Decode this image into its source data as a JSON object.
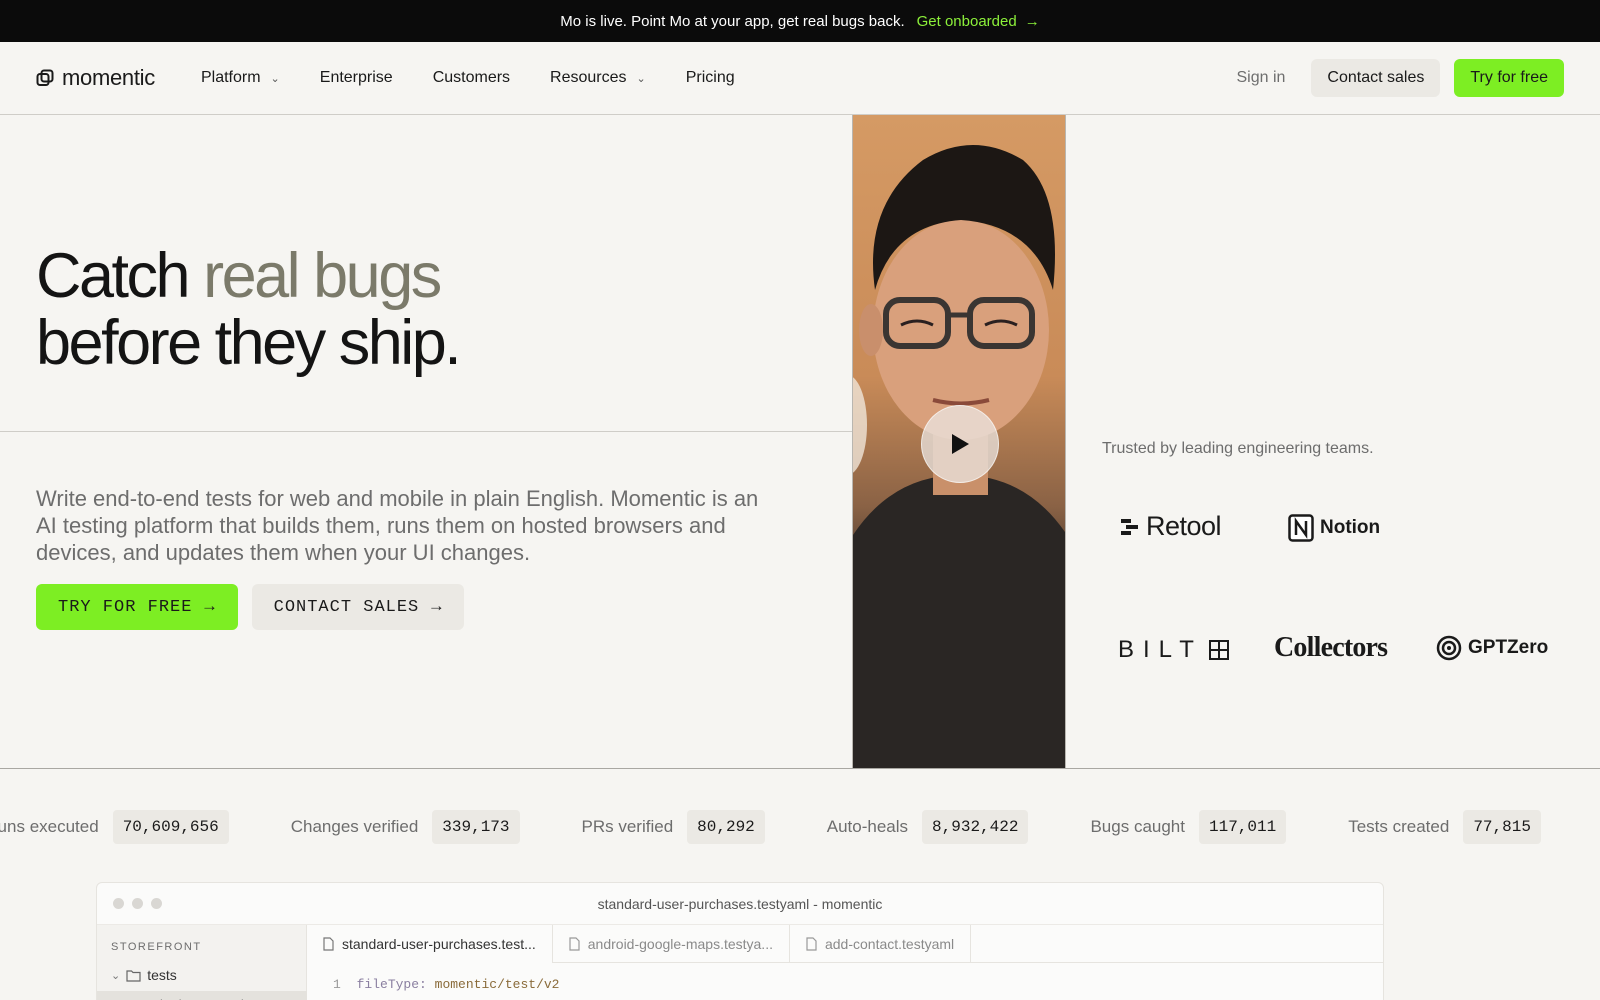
{
  "announcement": {
    "text": "Mo is live. Point Mo at your app, get real bugs back.",
    "cta": "Get onboarded"
  },
  "nav": {
    "brand": "momentic",
    "items": [
      {
        "label": "Platform",
        "dropdown": true
      },
      {
        "label": "Enterprise",
        "dropdown": false
      },
      {
        "label": "Customers",
        "dropdown": false
      },
      {
        "label": "Resources",
        "dropdown": true
      },
      {
        "label": "Pricing",
        "dropdown": false
      }
    ],
    "sign_in": "Sign in",
    "contact_sales": "Contact sales",
    "try_free": "Try for free"
  },
  "hero": {
    "headline_part1": "Catch ",
    "headline_highlight": "real bugs",
    "headline_part2": "before they ship.",
    "subtext": "Write end-to-end tests for web and mobile in plain English. Momentic is an AI testing platform that builds them, runs them on hosted browsers and devices, and updates them when your UI changes.",
    "cta_primary": "TRY FOR FREE",
    "cta_secondary": "CONTACT SALES"
  },
  "trusted": {
    "label": "Trusted by leading engineering teams.",
    "logos": [
      "Retool",
      "Notion",
      "BILT",
      "Collectors",
      "GPTZero"
    ]
  },
  "stats": [
    {
      "label": "Test runs executed",
      "value": "70,609,656"
    },
    {
      "label": "Changes verified",
      "value": "339,173"
    },
    {
      "label": "PRs verified",
      "value": "80,292"
    },
    {
      "label": "Auto-heals",
      "value": "8,932,422"
    },
    {
      "label": "Bugs caught",
      "value": "117,011"
    },
    {
      "label": "Tests created",
      "value": "77,815"
    }
  ],
  "ide": {
    "title": "standard-user-purchases.testyaml - momentic",
    "sidebar_section": "STOREFRONT",
    "folder": "tests",
    "selected_file": "standard-user-purch",
    "tabs": [
      "standard-user-purchases.test...",
      "android-google-maps.testya...",
      "add-contact.testyaml"
    ],
    "code_line_number": "1",
    "code_key": "fileType:",
    "code_value": "momentic/test/v2"
  },
  "colors": {
    "accent": "#7dee23",
    "cta_link": "#8cf03a",
    "background": "#f6f5f2",
    "announcement_bg": "#0b0b0b"
  }
}
